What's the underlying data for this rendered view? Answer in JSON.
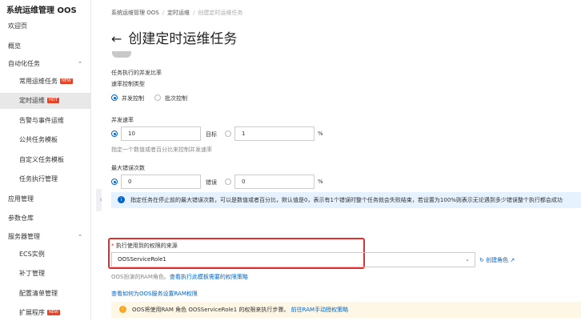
{
  "sidebar": {
    "title": "系统运维管理 OOS",
    "items": [
      {
        "label": "欢迎页"
      },
      {
        "label": "概览"
      },
      {
        "label": "自动化任务"
      },
      {
        "label": "常用运维任务",
        "badge": "NEW"
      },
      {
        "label": "定时运维",
        "badge": "HOT"
      },
      {
        "label": "告警与事件运维"
      },
      {
        "label": "公共任务模板"
      },
      {
        "label": "自定义任务模板"
      },
      {
        "label": "任务执行管理"
      },
      {
        "label": "应用管理"
      },
      {
        "label": "参数仓库"
      },
      {
        "label": "服务器管理"
      },
      {
        "label": "ECS实例"
      },
      {
        "label": "补丁管理"
      },
      {
        "label": "配置清单管理"
      },
      {
        "label": "扩展程序",
        "badge": "NEW"
      }
    ]
  },
  "breadcrumb": [
    "系统运维管理 OOS",
    "定时运维",
    "创建定时运维任务"
  ],
  "page_title": "创建定时运维任务",
  "concurrency": {
    "section_label": "任务执行的并发比率",
    "rate_control_label": "速率控制类型",
    "option_concurrent": "并发控制",
    "option_batch": "批次控制",
    "speed_label": "并发速率",
    "speed_value": "10",
    "target_label": "目标",
    "target_value": "1",
    "percent": "%",
    "speed_hint": "指定一个数值或者百分比来控制并发速率",
    "max_error_label": "最大错误次数",
    "max_error_value": "0",
    "error_label": "错误",
    "error_percent_value": "0",
    "error_info": "指定任务在停止前的最大错误次数，可以是数值或者百分比，默认值是0，表示有1个错误时整个任务就会失败结束，若设置为100%则表示无论遇到多少错误整个执行都会成功"
  },
  "permission": {
    "label": "执行使用到的权限的来源",
    "required_mark": "*",
    "role_value": "OOSServiceRole1",
    "create_role_link": "创建角色",
    "role_desc": "OOS扮演的RAM角色。",
    "policy_link": "查看执行此模板需要的权限策略",
    "howto_link": "查看如何为OOS服务设置RAM权限",
    "warn_text": "OOS将使用RAM 角色 OOSServiceRole1 的权限来执行步骤。",
    "warn_link": "前往RAM手动授权策略"
  },
  "colors": {
    "primary": "#0064c8",
    "danger": "#e03030",
    "info_bg": "#e6f2ff",
    "warn_bg": "#fff7e6"
  }
}
